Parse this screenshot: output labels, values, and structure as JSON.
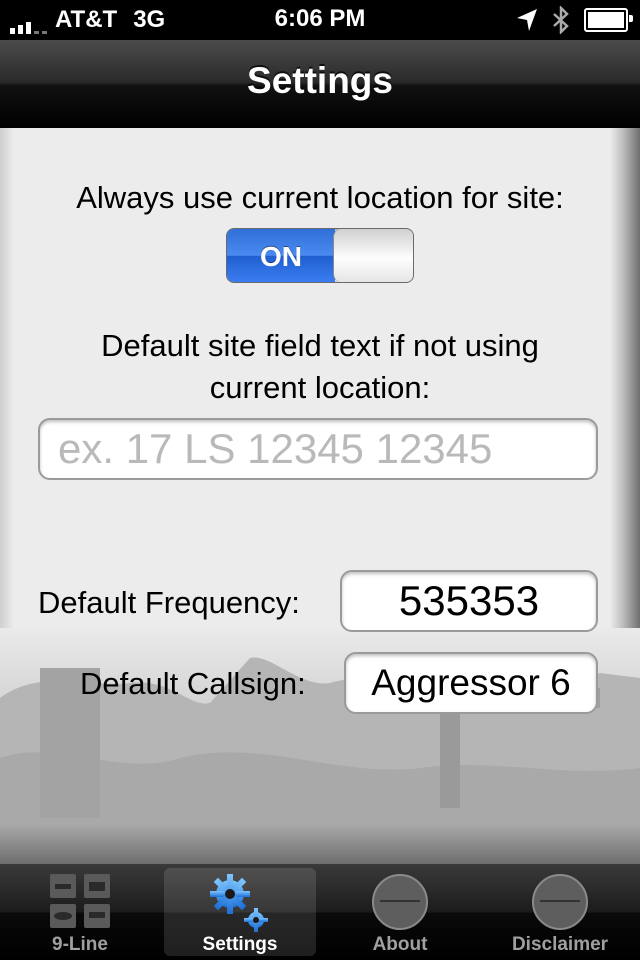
{
  "status_bar": {
    "carrier": "AT&T",
    "network": "3G",
    "time": "6:06 PM"
  },
  "nav": {
    "title": "Settings"
  },
  "settings": {
    "location_label": "Always use current location for site:",
    "location_switch": "ON",
    "site_text_label_line1": "Default site field text if not using",
    "site_text_label_line2": "current location:",
    "site_placeholder": "ex. 17 LS 12345 12345",
    "frequency_label": "Default Frequency:",
    "frequency_value": "535353",
    "callsign_label": "Default Callsign:",
    "callsign_value": "Aggressor 6"
  },
  "tabs": [
    {
      "label": "9-Line",
      "icon": "nine-line-icon",
      "active": false
    },
    {
      "label": "Settings",
      "icon": "gears-icon",
      "active": true
    },
    {
      "label": "About",
      "icon": "fa53-badge-icon",
      "active": false
    },
    {
      "label": "Disclaimer",
      "icon": "fa53-badge-icon",
      "active": false
    }
  ],
  "colors": {
    "switch_on": "#3b7df0",
    "tab_active": "#ffffff",
    "tab_inactive": "#a0a0a0"
  }
}
